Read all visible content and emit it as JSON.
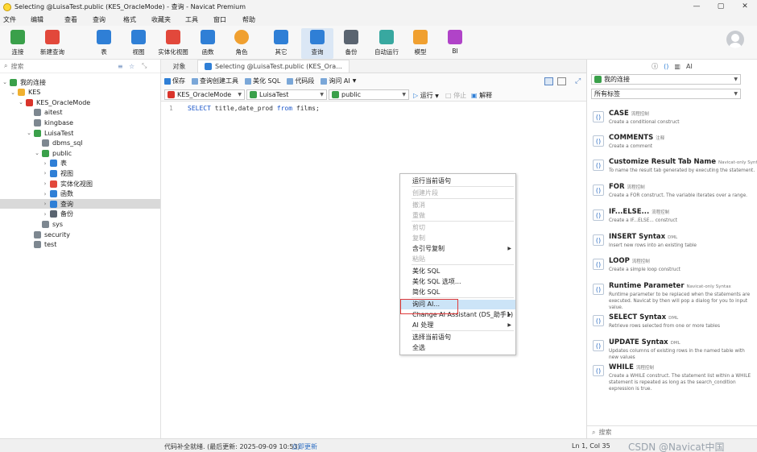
{
  "window": {
    "title": "Selecting @LuisaTest.public (KES_OracleMode) - 查询 - Navicat Premium",
    "controls": [
      "—",
      "▢",
      "✕"
    ]
  },
  "menu": [
    "文件",
    "编辑",
    "查看",
    "查询",
    "格式",
    "收藏夹",
    "工具",
    "窗口",
    "帮助"
  ],
  "toolbar": {
    "items": [
      {
        "label": "连接",
        "icon": "plug-icon",
        "color": "#3aa04a"
      },
      {
        "label": "新建查询",
        "icon": "new-query-icon",
        "color": "#e2483b"
      },
      {
        "label": "表",
        "icon": "table-icon",
        "color": "#2f7fd6"
      },
      {
        "label": "视图",
        "icon": "view-icon",
        "color": "#2f7fd6"
      },
      {
        "label": "实体化视图",
        "icon": "materialized-view-icon",
        "color": "#e2483b"
      },
      {
        "label": "函数",
        "icon": "function-icon",
        "color": "#2f7fd6"
      },
      {
        "label": "角色",
        "icon": "user-icon",
        "color": "#f0a030"
      },
      {
        "label": "其它",
        "icon": "tools-icon",
        "color": "#2f7fd6"
      },
      {
        "label": "查询",
        "icon": "query-icon",
        "color": "#2f7fd6",
        "active": true
      },
      {
        "label": "备份",
        "icon": "backup-icon",
        "color": "#5a6470"
      },
      {
        "label": "自动运行",
        "icon": "robot-icon",
        "color": "#38a8a0"
      },
      {
        "label": "模型",
        "icon": "model-icon",
        "color": "#f0a030"
      },
      {
        "label": "BI",
        "icon": "bi-icon",
        "color": "#b043c8"
      }
    ]
  },
  "left": {
    "search_placeholder": "搜索",
    "tree": [
      {
        "label": "我的连接",
        "depth": 0,
        "icon": "connections-icon",
        "color": "#3aa04a",
        "chev": "down"
      },
      {
        "label": "KES",
        "depth": 1,
        "icon": "folder-icon",
        "color": "#f0b030",
        "chev": "down"
      },
      {
        "label": "KES_OracleMode",
        "depth": 2,
        "icon": "kes-connection-icon",
        "color": "#d9342b",
        "chev": "down"
      },
      {
        "label": "aitest",
        "depth": 3,
        "icon": "database-icon",
        "color": "#7d8790",
        "chev": ""
      },
      {
        "label": "kingbase",
        "depth": 3,
        "icon": "database-icon",
        "color": "#7d8790",
        "chev": ""
      },
      {
        "label": "LuisaTest",
        "depth": 3,
        "icon": "database-icon",
        "color": "#3aa04a",
        "chev": "down"
      },
      {
        "label": "dbms_sql",
        "depth": 4,
        "icon": "schema-icon",
        "color": "#7d8790",
        "chev": ""
      },
      {
        "label": "public",
        "depth": 4,
        "icon": "schema-icon",
        "color": "#3aa04a",
        "chev": "down"
      },
      {
        "label": "表",
        "depth": 5,
        "icon": "table-icon",
        "color": "#2f7fd6",
        "chev": "right"
      },
      {
        "label": "视图",
        "depth": 5,
        "icon": "view-icon",
        "color": "#2f7fd6",
        "chev": "right"
      },
      {
        "label": "实体化视图",
        "depth": 5,
        "icon": "materialized-view-icon",
        "color": "#e2483b",
        "chev": "right"
      },
      {
        "label": "函数",
        "depth": 5,
        "icon": "function-icon",
        "color": "#2f7fd6",
        "chev": "right"
      },
      {
        "label": "查询",
        "depth": 5,
        "icon": "query-icon",
        "color": "#2f7fd6",
        "chev": "right",
        "selected": true
      },
      {
        "label": "备份",
        "depth": 5,
        "icon": "backup-icon",
        "color": "#5a6470",
        "chev": "right"
      },
      {
        "label": "sys",
        "depth": 4,
        "icon": "schema-icon",
        "color": "#7d8790",
        "chev": ""
      },
      {
        "label": "security",
        "depth": 3,
        "icon": "database-icon",
        "color": "#7d8790",
        "chev": ""
      },
      {
        "label": "test",
        "depth": 3,
        "icon": "database-icon",
        "color": "#7d8790",
        "chev": ""
      }
    ]
  },
  "tabs": [
    {
      "label": "对象",
      "active": false
    },
    {
      "label": "Selecting @LuisaTest.public (KES_Ora...",
      "active": true
    }
  ],
  "editor_toolbar": {
    "save": "保存",
    "query_builder": "查询创建工具",
    "beautify": "美化 SQL",
    "snippet": "代码段",
    "ask_ai": "询问 AI"
  },
  "selectors": {
    "connection": "KES_OracleMode",
    "database": "LuisaTest",
    "schema": "public",
    "run": "运行",
    "stop": "停止",
    "explain": "解释"
  },
  "editor": {
    "line_number": "1",
    "kw1": "SELECT",
    "mid": " title,date_prod ",
    "kw2": "from",
    "tail": " films;"
  },
  "context_menu": {
    "items": [
      {
        "label": "运行当前语句",
        "disabled": false
      },
      {
        "label": "创建片段",
        "disabled": true
      },
      {
        "label": "撤消",
        "disabled": true
      },
      {
        "label": "重做",
        "disabled": true
      },
      {
        "label": "剪切",
        "disabled": true
      },
      {
        "label": "复制",
        "disabled": true
      },
      {
        "label": "含引号复制",
        "disabled": false,
        "submenu": true
      },
      {
        "label": "粘贴",
        "disabled": true
      },
      {
        "label": "美化 SQL",
        "disabled": false
      },
      {
        "label": "美化 SQL 选项...",
        "disabled": false
      },
      {
        "label": "简化 SQL",
        "disabled": false
      },
      {
        "label": "询问 AI...",
        "disabled": false,
        "highlighted": true
      },
      {
        "label": "Change AI Assistant (DS_助手1)",
        "disabled": false,
        "submenu": true
      },
      {
        "label": "AI 处理",
        "disabled": false,
        "submenu": true
      },
      {
        "label": "选择当前语句",
        "disabled": false
      },
      {
        "label": "全选",
        "disabled": false
      }
    ]
  },
  "right": {
    "header_icons": [
      "info-icon",
      "code-icon",
      "grid-icon",
      "ai-icon"
    ],
    "header_ai": "AI",
    "connection_select": "我的连接",
    "tag_select": "所有标签",
    "snippets": [
      {
        "name": "CASE",
        "tag": "流程控制",
        "desc": "Create a conditional construct"
      },
      {
        "name": "COMMENTS",
        "tag": "注释",
        "desc": "Create a comment"
      },
      {
        "name": "Customize Result Tab Name",
        "tag": "Navicat-only Syntax",
        "desc": "To name the result tab generated by executing the statement."
      },
      {
        "name": "FOR",
        "tag": "流程控制",
        "desc": "Create a FOR construct. The variable iterates over a range."
      },
      {
        "name": "IF...ELSE...",
        "tag": "流程控制",
        "desc": "Create a IF...ELSE... construct"
      },
      {
        "name": "INSERT Syntax",
        "tag": "DML",
        "desc": "Insert new rows into an existing table"
      },
      {
        "name": "LOOP",
        "tag": "流程控制",
        "desc": "Create a simple loop construct"
      },
      {
        "name": "Runtime Parameter",
        "tag": "Navicat-only Syntax",
        "desc": "Runtime parameter to be replaced when the statements are executed. Navicat by then will pop a dialog for you to input value."
      },
      {
        "name": "SELECT Syntax",
        "tag": "DML",
        "desc": "Retrieve rows selected from one or more tables"
      },
      {
        "name": "UPDATE Syntax",
        "tag": "DML",
        "desc": "Updates columns of existing rows in the named table with new values"
      },
      {
        "name": "WHILE",
        "tag": "流程控制",
        "desc": "Create a WHILE construct. The statement list within a WHILE statement is repeated as long as the search_condition expression is true."
      }
    ],
    "search_placeholder": "搜索"
  },
  "status": {
    "left": "代码补全就绪. (最后更新: 2025-09-09 10:53)",
    "link": "立即更新",
    "position": "Ln 1, Col 35",
    "watermark": "CSDN @Navicat中国"
  }
}
